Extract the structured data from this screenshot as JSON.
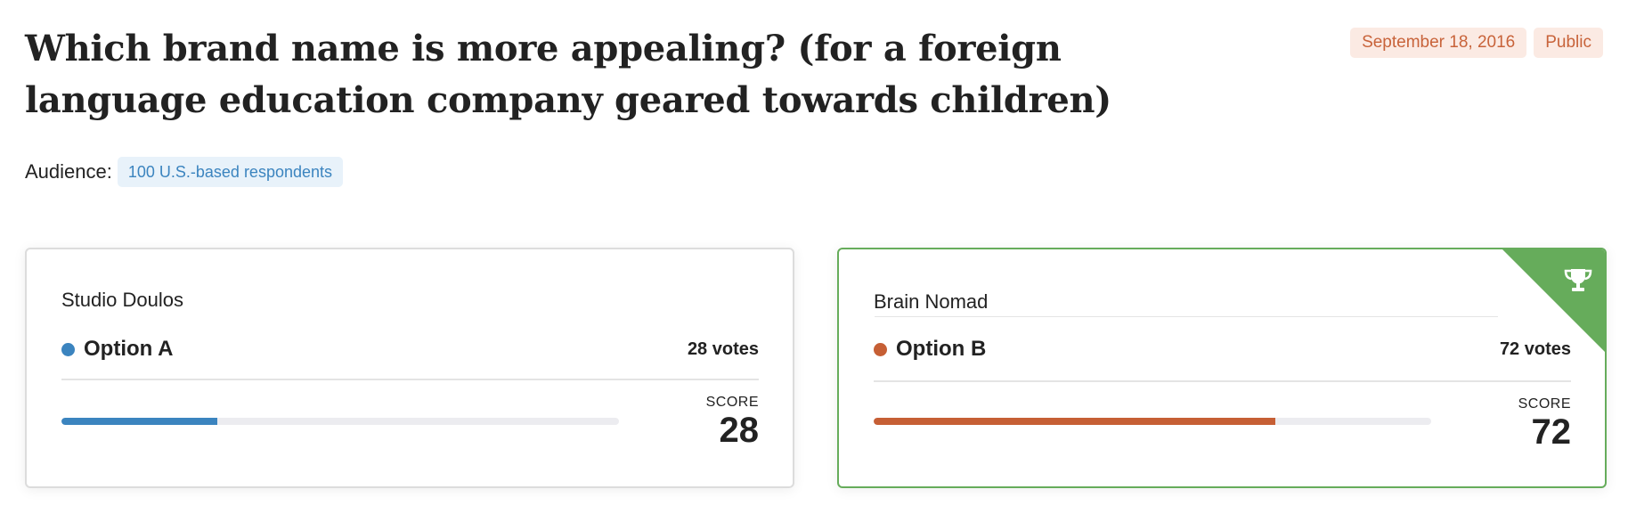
{
  "question": {
    "title": "Which brand name is more appealing? (for a foreign language education company geared towards children)",
    "date": "September 18, 2016",
    "visibility": "Public"
  },
  "audience": {
    "label": "Audience:",
    "value": "100 U.S.-based respondents"
  },
  "score_label": "SCORE",
  "options": [
    {
      "name": "Studio Doulos",
      "label": "Option A",
      "votes": "28 votes",
      "score": "28",
      "percent": 28,
      "color": "#3b84bf",
      "winner": false
    },
    {
      "name": "Brain Nomad",
      "label": "Option B",
      "votes": "72 votes",
      "score": "72",
      "percent": 72,
      "color": "#c65f35",
      "winner": true,
      "badge_icon": "trophy-icon"
    }
  ]
}
